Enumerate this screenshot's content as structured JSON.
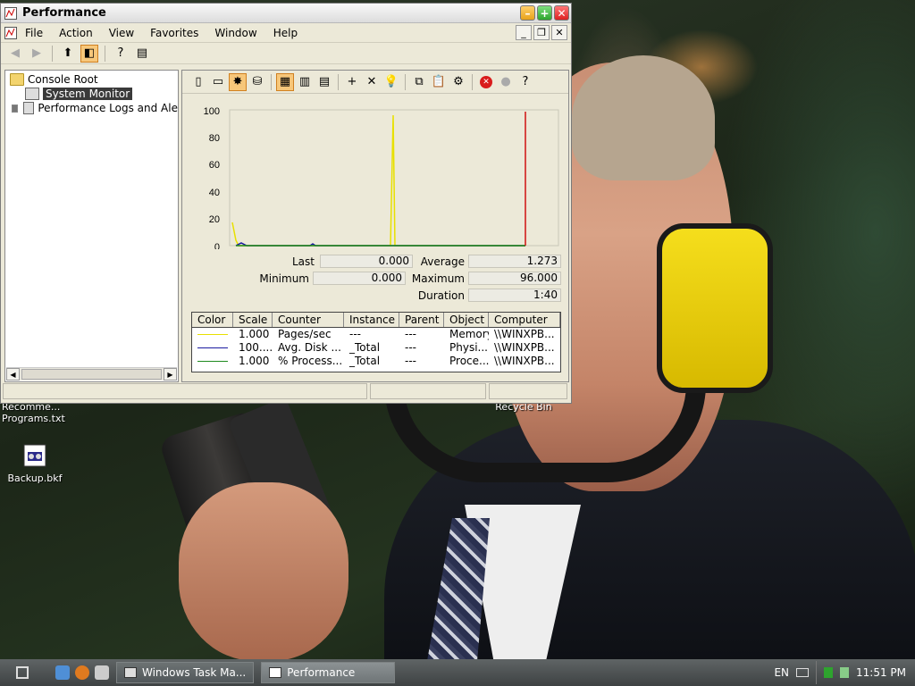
{
  "window": {
    "title": "Performance",
    "menu": [
      "File",
      "Action",
      "View",
      "Favorites",
      "Window",
      "Help"
    ]
  },
  "tree": {
    "root": "Console Root",
    "items": [
      "System Monitor",
      "Performance Logs and Ale"
    ]
  },
  "graph": {
    "y_ticks": [
      "100",
      "80",
      "60",
      "40",
      "20",
      "0"
    ]
  },
  "stats": {
    "last_label": "Last",
    "last_value": "0.000",
    "average_label": "Average",
    "average_value": "1.273",
    "minimum_label": "Minimum",
    "minimum_value": "0.000",
    "maximum_label": "Maximum",
    "maximum_value": "96.000",
    "duration_label": "Duration",
    "duration_value": "1:40"
  },
  "legend": {
    "headers": [
      "Color",
      "Scale",
      "Counter",
      "Instance",
      "Parent",
      "Object",
      "Computer"
    ],
    "rows": [
      {
        "color": "#e8e000",
        "scale": "1.000",
        "counter": "Pages/sec",
        "instance": "---",
        "parent": "---",
        "object": "Memory",
        "computer": "\\\\WINXPB..."
      },
      {
        "color": "#1a1aa0",
        "scale": "100....",
        "counter": "Avg. Disk ...",
        "instance": "_Total",
        "parent": "---",
        "object": "Physi...",
        "computer": "\\\\WINXPB..."
      },
      {
        "color": "#1e8a1e",
        "scale": "1.000",
        "counter": "% Process...",
        "instance": "_Total",
        "parent": "---",
        "object": "Proce...",
        "computer": "\\\\WINXPB..."
      }
    ]
  },
  "desktop": {
    "icons": [
      {
        "label1": "Recomme...",
        "label2": "Programs.txt"
      },
      {
        "label1": "Backup.bkf"
      },
      {
        "label1": "Recycle Bin"
      }
    ]
  },
  "taskbar": {
    "tasks": [
      "Windows Task Ma...",
      "Performance"
    ],
    "lang": "EN",
    "clock": "11:51 PM"
  },
  "icons": {
    "app": "performance-app-icon",
    "start": "start-icon"
  }
}
